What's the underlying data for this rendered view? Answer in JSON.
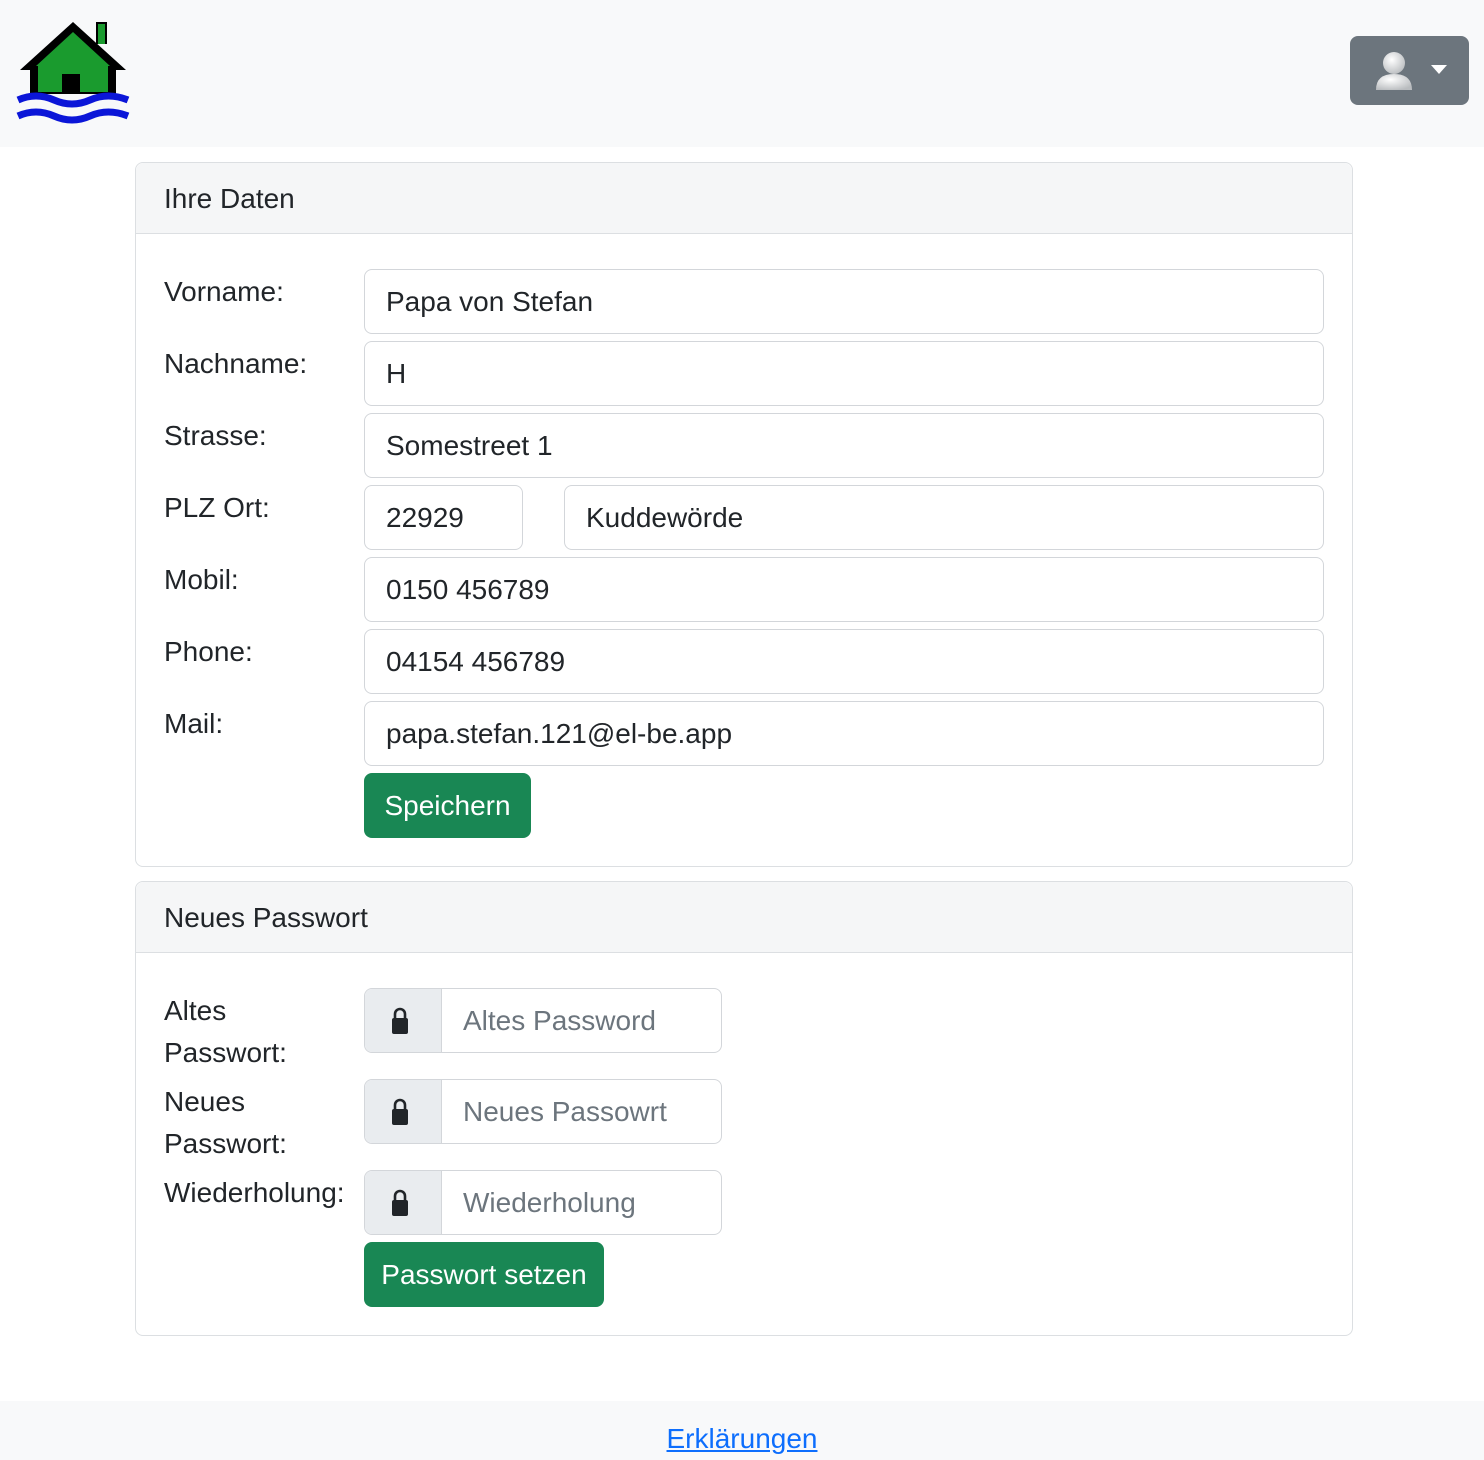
{
  "header": {
    "logo_icon": "house-on-water-logo",
    "user_menu_icon": "user-avatar-icon",
    "colors": {
      "logo_house": "#1a9b2e",
      "logo_water": "#0b16d8",
      "navbar_bg": "#f8f9fa",
      "user_button_bg": "#6c757d"
    }
  },
  "personal_data": {
    "title": "Ihre Daten",
    "fields": {
      "vorname": {
        "label": "Vorname:",
        "value": "Papa von Stefan"
      },
      "nachname": {
        "label": "Nachname:",
        "value": "H"
      },
      "strasse": {
        "label": "Strasse:",
        "value": "Somestreet 1"
      },
      "plz_ort": {
        "label": "PLZ Ort:",
        "plz_value": "22929",
        "ort_value": "Kuddewörde"
      },
      "mobil": {
        "label": "Mobil:",
        "value": "0150 456789"
      },
      "phone": {
        "label": "Phone:",
        "value": "04154 456789"
      },
      "mail": {
        "label": "Mail:",
        "value": "papa.stefan.121@el-be.app"
      }
    },
    "save_label": "Speichern",
    "button_color": "#198754"
  },
  "password": {
    "title": "Neues Passwort",
    "old": {
      "label_line1": "Altes",
      "label_line2": "Passwort:",
      "placeholder": "Altes Password"
    },
    "new": {
      "label_line1": "Neues",
      "label_line2": "Passwort:",
      "placeholder": "Neues Passowrt"
    },
    "repeat": {
      "label": "Wiederholung:",
      "placeholder": "Wiederholung"
    },
    "addon_icon": "lock-icon",
    "submit_label": "Passwort setzen"
  },
  "footer": {
    "link_label": "Erklärungen"
  }
}
